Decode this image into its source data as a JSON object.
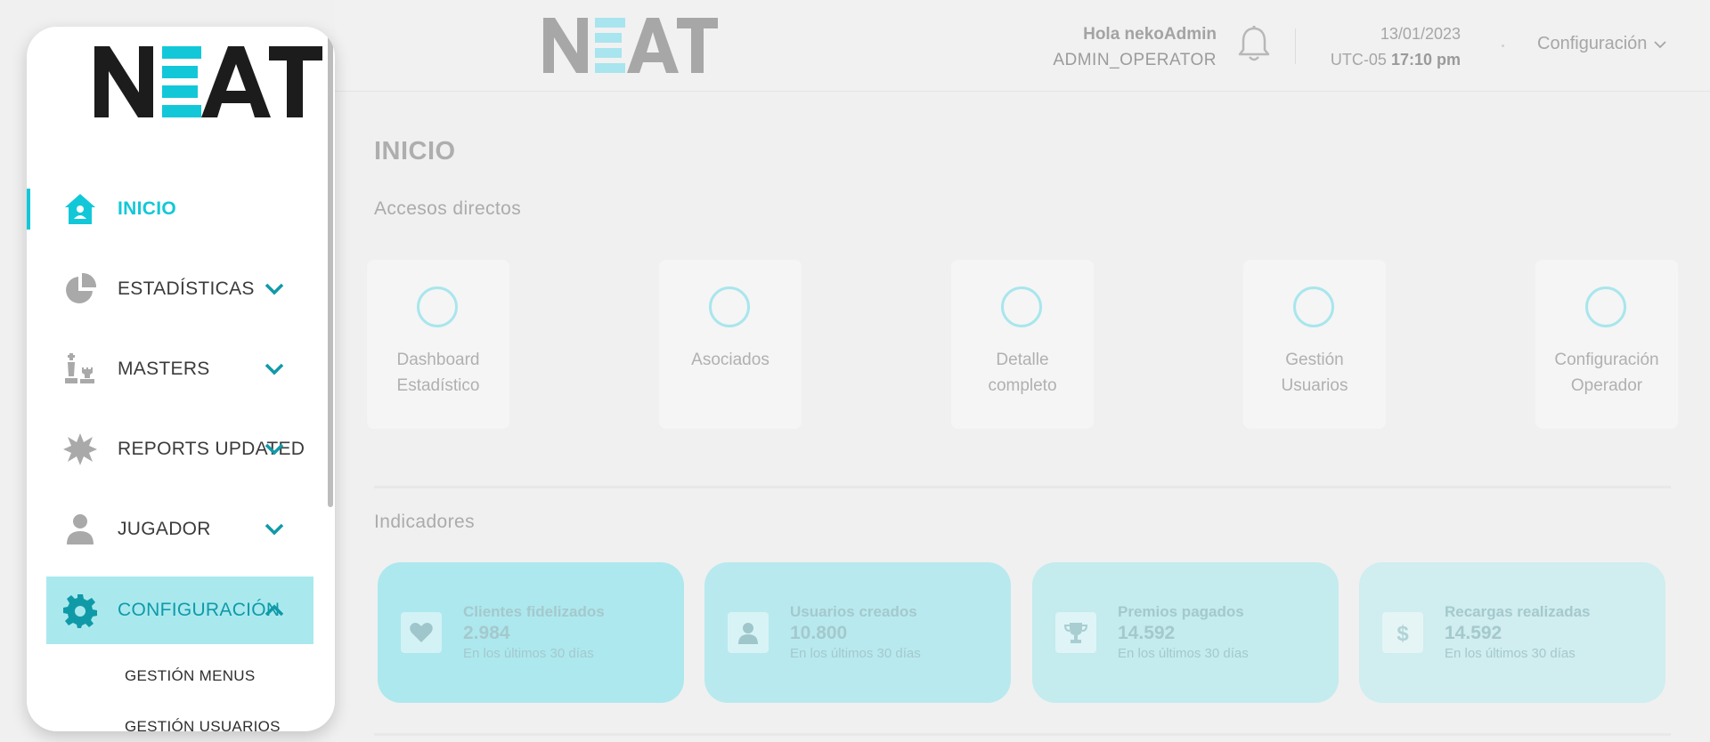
{
  "header": {
    "greeting": "Hola nekoAdmin",
    "role": "ADMIN_OPERATOR",
    "date": "13/01/2023",
    "timezone": "UTC-05",
    "time": "17:10 pm",
    "config_label": "Configuración"
  },
  "brand": {
    "logo_text": "NEAT"
  },
  "sidebar": {
    "items": [
      {
        "label": "INICIO",
        "icon": "home-icon"
      },
      {
        "label": "ESTADÍSTICAS",
        "icon": "pie-chart-icon"
      },
      {
        "label": "MASTERS",
        "icon": "chess-icon"
      },
      {
        "label": "REPORTS UPDATED",
        "icon": "badge-icon"
      },
      {
        "label": "JUGADOR",
        "icon": "user-icon"
      },
      {
        "label": "CONFIGURACIÓN",
        "icon": "gear-icon"
      }
    ],
    "subitems": [
      "GESTIÓN MENUS",
      "GESTIÓN USUARIOS"
    ]
  },
  "main": {
    "title": "INICIO",
    "shortcuts_title": "Accesos directos",
    "shortcuts": [
      {
        "label": "Dashboard\nEstadístico"
      },
      {
        "label": "Asociados"
      },
      {
        "label": "Detalle\ncompleto"
      },
      {
        "label": "Gestión\nUsuarios"
      },
      {
        "label": "Configuración\nOperador"
      }
    ],
    "indicators_title": "Indicadores",
    "indicators": [
      {
        "title": "Clientes fidelizados",
        "value": "2.984",
        "note": "En los últimos 30 días",
        "icon": "heart-icon",
        "color": "#ade8ee"
      },
      {
        "title": "Usuarios creados",
        "value": "10.800",
        "note": "En los últimos 30 días",
        "icon": "user-icon",
        "color": "#b8e9ee"
      },
      {
        "title": "Premios pagados",
        "value": "14.592",
        "note": "En los últimos 30 días",
        "icon": "trophy-icon",
        "color": "#c4ebee"
      },
      {
        "title": "Recargas realizadas",
        "value": "14.592",
        "note": "En los últimos 30 días",
        "icon": "dollar-icon",
        "color": "#d0edef"
      }
    ]
  },
  "colors": {
    "accent": "#12c8d8",
    "accent_dark": "#109aa8",
    "logo_dark": "#1c1c1c",
    "logo_muted": "#a7a7a7"
  }
}
